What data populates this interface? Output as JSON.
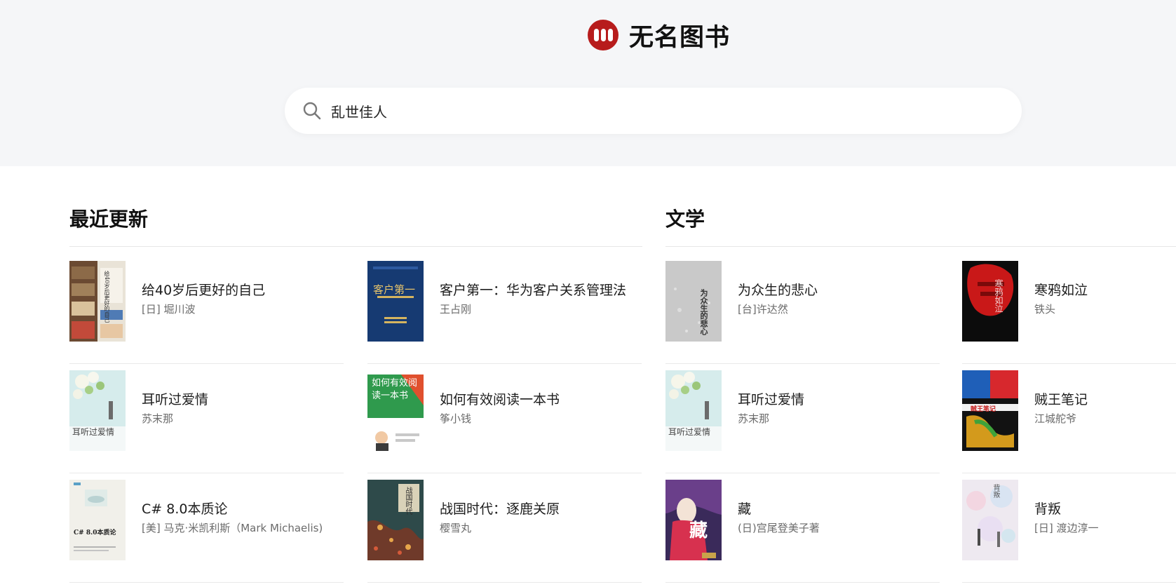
{
  "brand": {
    "name": "无名图书",
    "accent": "#b71c1c"
  },
  "search": {
    "value": "乱世佳人",
    "placeholder": ""
  },
  "sections": [
    {
      "title": "最近更新",
      "books": [
        {
          "title": "给40岁后更好的自己",
          "author": "[日] 堀川波",
          "cover_text": "给40岁后更好的自己"
        },
        {
          "title": "客户第一：华为客户关系管理法",
          "author": "王占刚",
          "cover_text": "客户第一"
        },
        {
          "title": "耳听过爱情",
          "author": "苏末那",
          "cover_text": "耳听过爱情"
        },
        {
          "title": "如何有效阅读一本书",
          "author": "筝小钱",
          "cover_text": "如何有效阅读一本书"
        },
        {
          "title": "C# 8.0本质论",
          "author": "[美] 马克·米凯利斯（Mark Michaelis)",
          "cover_text": "C# 8.0本质论"
        },
        {
          "title": "战国时代：逐鹿关原",
          "author": "樱雪丸",
          "cover_text": "战国时代"
        }
      ]
    },
    {
      "title": "文学",
      "books": [
        {
          "title": "为众生的悲心",
          "author": "[台]许达然",
          "cover_text": "为众生的悲心"
        },
        {
          "title": "寒鸦如泣",
          "author": "铁头",
          "cover_text": "寒鸦如泣"
        },
        {
          "title": "耳听过爱情",
          "author": "苏末那",
          "cover_text": "耳听过爱情"
        },
        {
          "title": "贼王笔记",
          "author": "江城舵爷",
          "cover_text": "贼王笔记"
        },
        {
          "title": "藏",
          "author": "(日)宫尾登美子著",
          "cover_text": "藏"
        },
        {
          "title": "背叛",
          "author": "[日] 渡边淳一",
          "cover_text": "背叛"
        }
      ]
    }
  ]
}
